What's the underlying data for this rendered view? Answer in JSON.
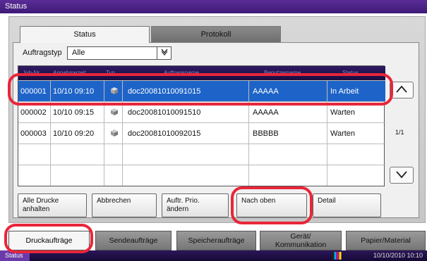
{
  "window": {
    "title": "Status"
  },
  "top_tabs": [
    {
      "label": "Status"
    },
    {
      "label": "Protokoll"
    }
  ],
  "filter": {
    "label": "Auftragstyp",
    "value": "Alle"
  },
  "table": {
    "columns": [
      "Job-Nr.",
      "Annahmezeit",
      "Typ",
      "Auftragsname",
      "Benutzername",
      "Status"
    ],
    "rows": [
      {
        "job": "000001",
        "time": "10/10 09:10",
        "name": "doc20081010091015",
        "user": "AAAAA",
        "status": "In Arbeit"
      },
      {
        "job": "000002",
        "time": "10/10 09:15",
        "name": "doc20081010091510",
        "user": "AAAAA",
        "status": "Warten"
      },
      {
        "job": "000003",
        "time": "10/10 09:20",
        "name": "doc20081010092015",
        "user": "BBBBB",
        "status": "Warten"
      }
    ]
  },
  "pager": {
    "text": "1/1"
  },
  "actions": {
    "pause_all_line1": "Alle Drucke",
    "pause_all_line2": "anhalten",
    "cancel": "Abbrechen",
    "priority_line1": "Auftr. Prio.",
    "priority_line2": "ändern",
    "move_up": "Nach oben",
    "detail": "Detail"
  },
  "bottom_tabs": {
    "print": "Druckaufträge",
    "send": "Sendeaufträge",
    "storage": "Speicheraufträge",
    "device_line1": "Gerät/",
    "device_line2": "Kommunikation",
    "paper": "Papier/Material"
  },
  "statusbar": {
    "label": "Status",
    "datetime": "10/10/2010 10:10"
  },
  "colors": {
    "accent": "#3e1a78",
    "selected_row": "#1e64c8",
    "highlight": "#e8263a"
  },
  "icons": {
    "job_type": "printer-job-icon",
    "scroll_up": "chevron-up-icon",
    "scroll_down": "chevron-down-icon",
    "toner": "toner-icon"
  }
}
